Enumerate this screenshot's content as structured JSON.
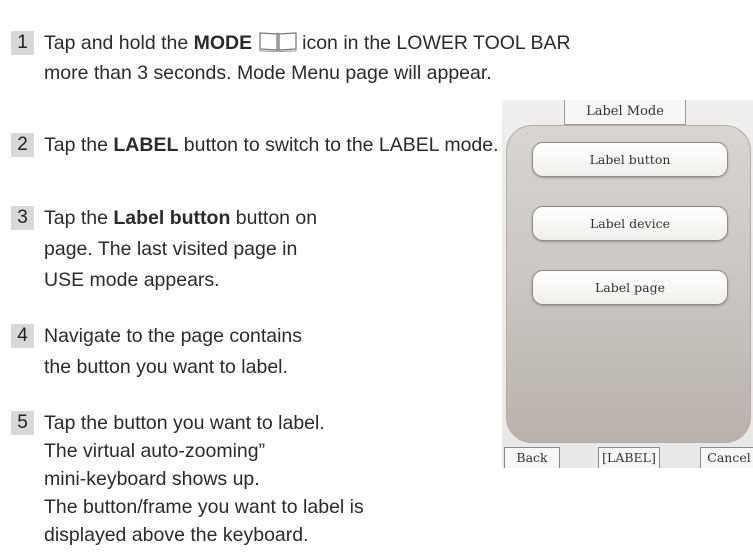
{
  "steps": [
    {
      "number": "1",
      "lines": [
        "Tap and hold the",
        "MODE",
        "icon in the LOWER TOOL BAR",
        "more than 3 seconds. Mode Menu page will appear."
      ]
    },
    {
      "number": "2",
      "lines": [
        "Tap the ",
        "LABEL",
        " button to switch to the LABEL mode."
      ]
    },
    {
      "number": "3",
      "lines": [
        "Tap the ",
        "Label button",
        " button on",
        "page. The last visited page in",
        "USE mode appears."
      ]
    },
    {
      "number": "4",
      "lines": [
        "Navigate to the page contains",
        "the button you want to label."
      ]
    },
    {
      "number": "5",
      "lines": [
        "Tap the button you want to label.",
        "The virtual  auto-zooming”",
        "mini-keyboard shows up.",
        "The button/frame you want to label is",
        "displayed above the keyboard."
      ]
    }
  ],
  "device": {
    "title": "Label Mode",
    "buttons": [
      "Label button",
      "Label device",
      "Label page"
    ],
    "toolbar": {
      "back": "Back",
      "label": "[LABEL]",
      "cancel": "Cancel"
    }
  }
}
